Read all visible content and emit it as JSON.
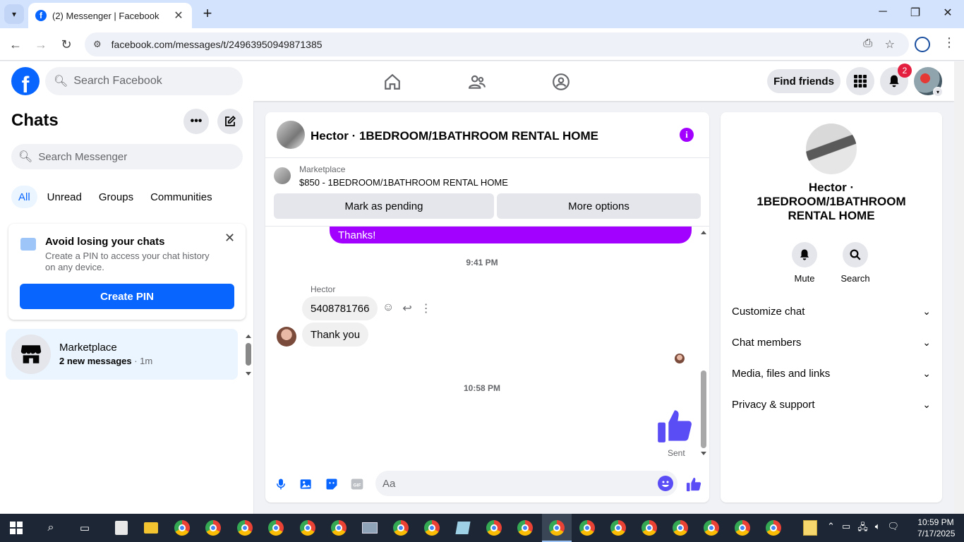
{
  "browser": {
    "tab_title": "(2) Messenger | Facebook",
    "url": "facebook.com/messages/t/24963950949871385"
  },
  "header": {
    "search_placeholder": "Search Facebook",
    "find_friends": "Find friends",
    "notification_count": "2"
  },
  "chats": {
    "title": "Chats",
    "search_placeholder": "Search Messenger",
    "filters": [
      "All",
      "Unread",
      "Groups",
      "Communities"
    ],
    "pin_card": {
      "title": "Avoid losing your chats",
      "description": "Create a PIN to access your chat history on any device.",
      "button": "Create PIN"
    },
    "items": [
      {
        "name": "Marketplace",
        "preview": "2 new messages",
        "time": " · 1m"
      }
    ]
  },
  "conversation": {
    "title": "Hector · 1BEDROOM/1BATHROOM RENTAL HOME",
    "marketplace_label": "Marketplace",
    "listing": "$850 - 1BEDROOM/1BATHROOM RENTAL HOME",
    "mark_pending": "Mark as pending",
    "more_options": "More options",
    "messages": {
      "thanks": "Thanks!",
      "time1": "9:41 PM",
      "sender": "Hector",
      "phone": "5408781766",
      "thank_you": "Thank you",
      "time2": "10:58 PM",
      "sent_status": "Sent"
    },
    "composer_placeholder": "Aa",
    "colors": {
      "accent": "#a200ff",
      "like": "#5b4df5"
    }
  },
  "info_panel": {
    "name": "Hector · 1BEDROOM/1BATHROOM RENTAL HOME",
    "mute": "Mute",
    "search": "Search",
    "sections": [
      "Customize chat",
      "Chat members",
      "Media, files and links",
      "Privacy & support"
    ]
  },
  "taskbar": {
    "time": "10:59 PM",
    "date": "7/17/2025"
  }
}
